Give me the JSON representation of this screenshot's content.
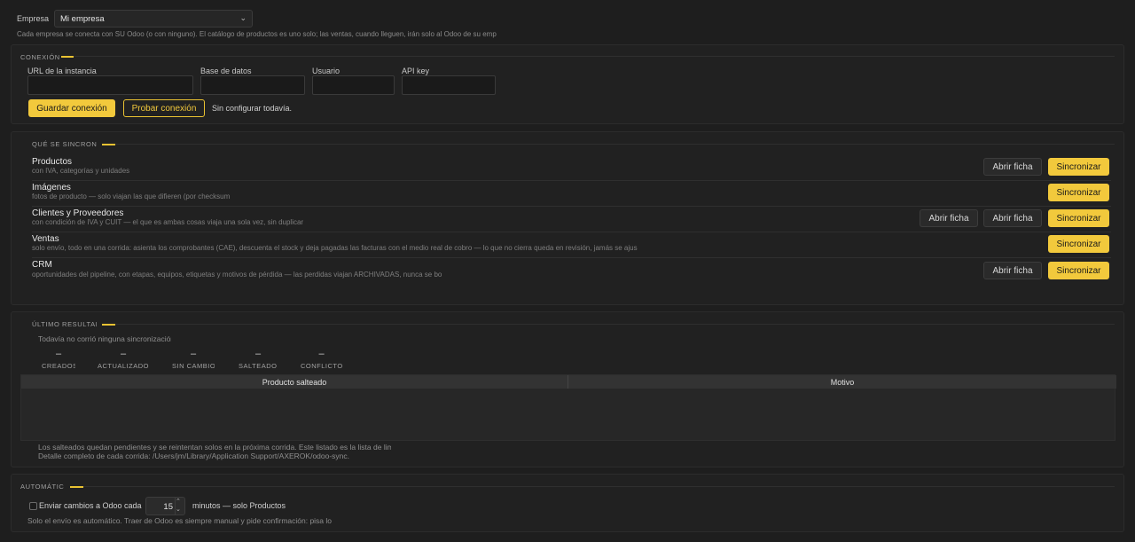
{
  "company": {
    "label": "Empresa",
    "selected": "Mi empresa",
    "hint": "Cada empresa se conecta con SU Odoo (o con ninguno). El catálogo de productos es uno solo; las ventas, cuando lleguen, irán solo al Odoo de su emp"
  },
  "connection": {
    "title": "CONEXIÓN",
    "fields": {
      "url": {
        "label": "URL de la instancia",
        "value": ""
      },
      "db": {
        "label": "Base de datos",
        "value": ""
      },
      "user": {
        "label": "Usuario",
        "value": ""
      },
      "apikey": {
        "label": "API key",
        "value": ""
      }
    },
    "save_label": "Guardar conexión",
    "test_label": "Probar conexión",
    "status": "Sin configurar todavía."
  },
  "sync": {
    "title": "QUÉ SE SINCRONIZA",
    "open_label": "Abrir ficha",
    "sync_label": "Sincronizar",
    "items": [
      {
        "title": "Productos",
        "desc": "con IVA, categorías y unidades"
      },
      {
        "title": "Imágenes",
        "desc": "fotos de producto — solo viajan las que difieren (por checksum"
      },
      {
        "title": "Clientes y Proveedores",
        "desc": "con condición de IVA y CUIT — el que es ambas cosas viaja una sola vez, sin duplicar"
      },
      {
        "title": "Ventas",
        "desc": "solo envío, todo en una corrida: asienta los comprobantes (CAE), descuenta el stock y deja pagadas las facturas con el medio real de cobro — lo que no cierra queda en revisión, jamás se ajus"
      },
      {
        "title": "CRM",
        "desc": "oportunidades del pipeline, con etapas, equipos, etiquetas y motivos de pérdida — las perdidas viajan ARCHIVADAS, nunca se bo"
      }
    ]
  },
  "result": {
    "title": "ÚLTIMO RESULTADO",
    "empty": "Todavía no corrió ninguna sincronización",
    "stats": [
      {
        "value": "–",
        "label": "CREADOS"
      },
      {
        "value": "–",
        "label": "ACTUALIZADOS"
      },
      {
        "value": "–",
        "label": "SIN CAMBIOS"
      },
      {
        "value": "–",
        "label": "SALTEADOS"
      },
      {
        "value": "–",
        "label": "CONFLICTOS"
      }
    ],
    "table": {
      "col1": "Producto salteado",
      "col2": "Motivo"
    },
    "note1": "Los salteados quedan pendientes y se reintentan solos en la próxima corrida. Este listado es la lista de limpi",
    "note2": "Detalle completo de cada corrida: /Users/jm/Library/Application Support/AXEROK/odoo-sync."
  },
  "auto": {
    "title": "AUTOMÁTICO",
    "checkbox_label": "Enviar cambios a Odoo cada",
    "minutes": "15",
    "suffix": "minutos — solo Productos",
    "note": "Solo el envío es automático. Traer de Odoo es siempre manual y pide confirmación: pisa lo lo"
  },
  "colors": {
    "accent": "#f2c93c",
    "background": "#1e1e1e",
    "panel": "#212121"
  }
}
